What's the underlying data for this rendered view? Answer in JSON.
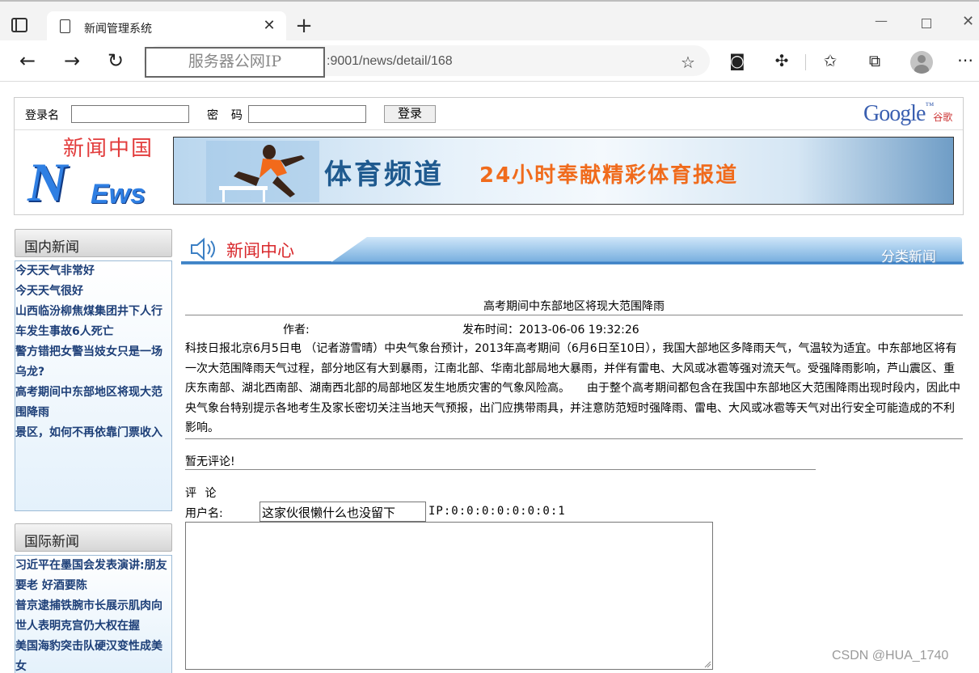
{
  "browser": {
    "tab_title": "新闻管理系统",
    "tab_close": "✕",
    "new_tab": "+",
    "address_masked": "服务器公网IP",
    "address_rest": ":9001/news/detail/168",
    "icons": [
      "tab-actions-icon",
      "page-icon",
      "back-icon",
      "forward-icon",
      "reload-icon",
      "favorite-add-icon",
      "immersive-reader-icon",
      "extensions-icon",
      "favorites-icon",
      "collections-icon",
      "profile-icon",
      "more-icon",
      "minimize-icon",
      "maximize-icon",
      "close-icon"
    ]
  },
  "header": {
    "login_label": "登录名",
    "password_label": "密 码",
    "login_button": "登录",
    "google_text": "Google",
    "google_tm": "™",
    "google_cn": "谷歌",
    "logo_cn": "新闻中国",
    "logo_n": "N",
    "logo_ews": "Ews",
    "banner_title": "体育频道",
    "banner_slogan": "24小时奉献精彩体育报道"
  },
  "sidebar": {
    "domestic_title": "国内新闻",
    "domestic_items": [
      "今天天气非常好",
      "今天天气很好",
      "山西临汾柳焦煤集团井下人行车发生事故6人死亡",
      "警方错把女警当妓女只是一场乌龙?",
      "高考期间中东部地区将现大范围降雨",
      "景区，如何不再依靠门票收入"
    ],
    "international_title": "国际新闻",
    "international_items": [
      "习近平在墨国会发表演讲:朋友要老 好酒要陈",
      "普京逮捕铁腕市长展示肌肉向世人表明克宫仍大权在握",
      "美国海豹突击队硬汉变性成美女"
    ]
  },
  "main": {
    "center_title": "新闻中心",
    "category": "分类新闻",
    "article_title": "高考期间中东部地区将现大范围降雨",
    "author_label": "作者:",
    "time_label": "发布时间：2013-06-06 19:32:26",
    "body": "科技日报北京6月5日电 （记者游雪晴）中央气象台预计，2013年高考期间（6月6日至10日），我国大部地区多降雨天气，气温较为适宜。中东部地区将有一次大范围降雨天气过程，部分地区有大到暴雨，江南北部、华南北部局地大暴雨，并伴有雷电、大风或冰雹等强对流天气。受强降雨影响，芦山震区、重庆东南部、湖北西南部、湖南西北部的局部地区发生地质灾害的气象风险高。　　由于整个高考期间都包含在我国中东部地区大范围降雨出现时段内，因此中央气象台特别提示各地考生及家长密切关注当地天气预报，出门应携带雨具，并注意防范短时强降雨、雷电、大风或冰雹等天气对出行安全可能造成的不利影响。",
    "no_comment": "暂无评论!",
    "comment_label": "评 论",
    "username_label": "用户名:",
    "username_value": "这家伙很懒什么也没留下",
    "ip_text": "IP:0:0:0:0:0:0:0:1"
  },
  "watermark": "CSDN @HUA_1740"
}
